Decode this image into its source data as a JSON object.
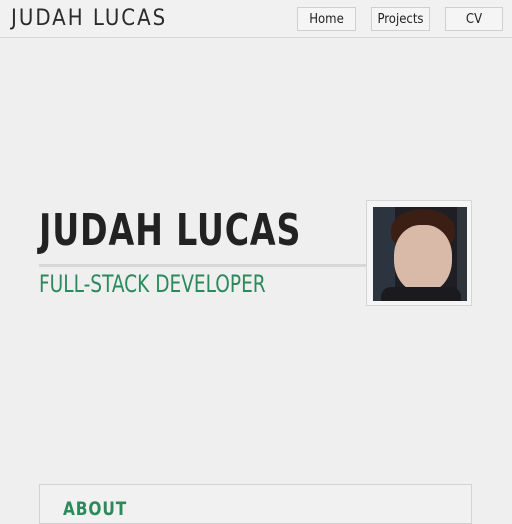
{
  "header": {
    "brand": "JUDAH LUCAS",
    "nav": [
      {
        "label": "Home"
      },
      {
        "label": "Projects"
      },
      {
        "label": "CV"
      }
    ]
  },
  "hero": {
    "name": "JUDAH LUCAS",
    "role": "FULL-STACK DEVELOPER",
    "avatar_alt": "profile-photo"
  },
  "sections": {
    "about_title": "ABOUT"
  },
  "colors": {
    "accent": "#2b8a5b",
    "background": "#efefef",
    "text": "#222222"
  }
}
